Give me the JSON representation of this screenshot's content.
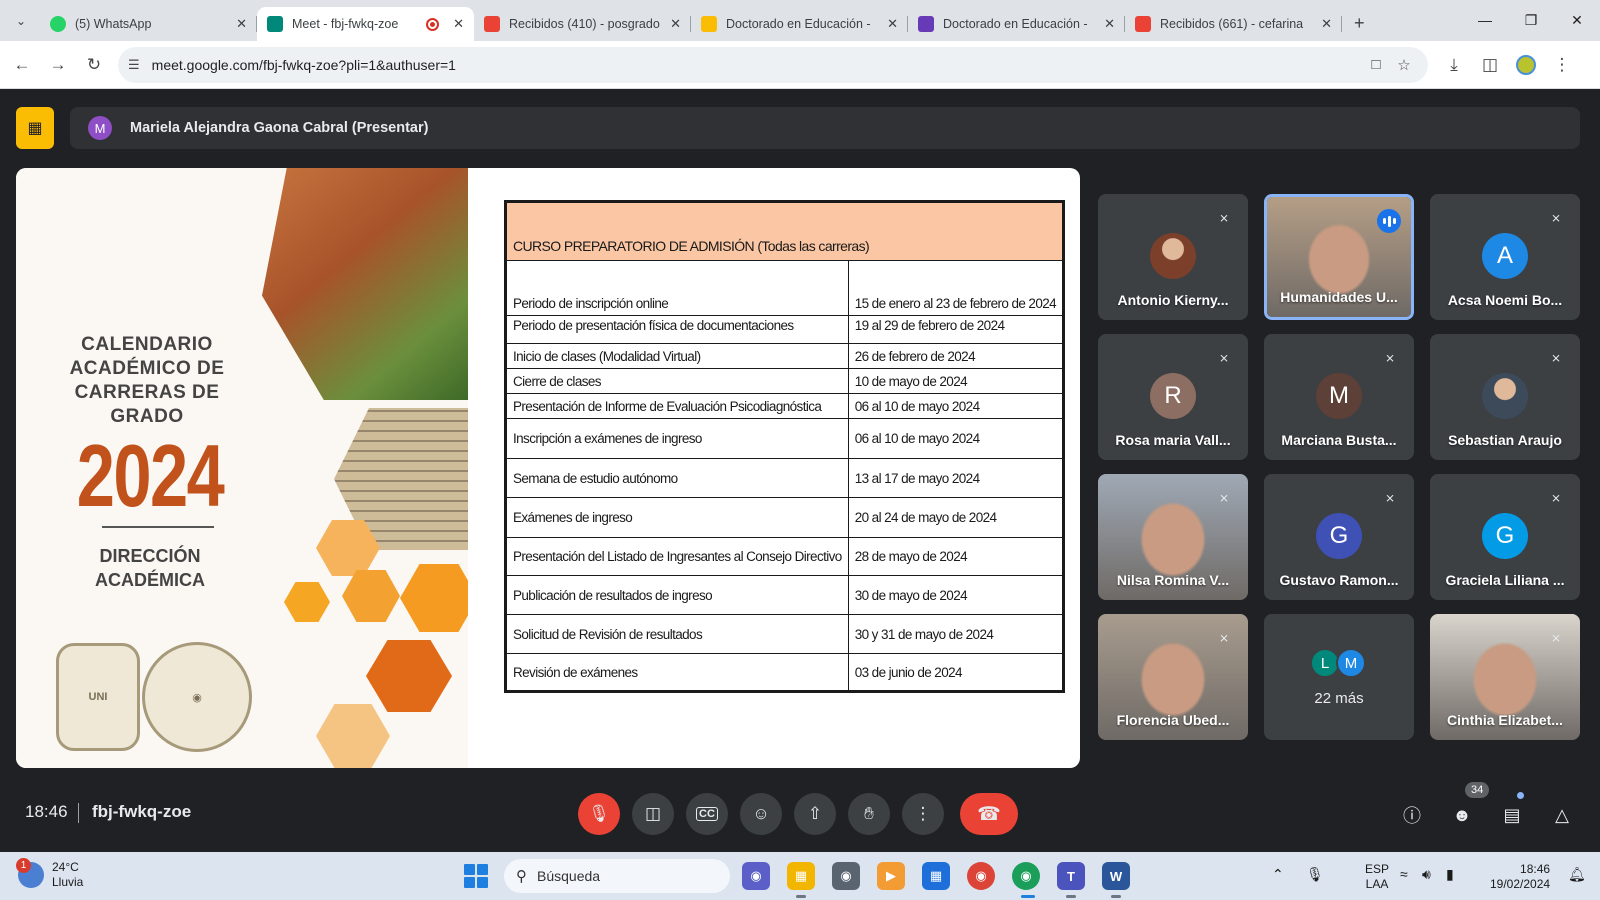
{
  "browser": {
    "tabs": [
      {
        "title": "(5) WhatsApp",
        "icon": "whatsapp-icon",
        "color": "#25d366",
        "active": false
      },
      {
        "title": "Meet - fbj-fwkq-zoe",
        "icon": "google-meet-icon",
        "color": "#00897b",
        "active": true,
        "recording": true
      },
      {
        "title": "Recibidos (410) - posgrado",
        "icon": "gmail-icon",
        "color": "#ea4335",
        "active": false
      },
      {
        "title": "Doctorado en Educación -",
        "icon": "google-drive-icon",
        "color": "#fbbc04",
        "active": false
      },
      {
        "title": "Doctorado en Educación -",
        "icon": "google-forms-icon",
        "color": "#673ab7",
        "active": false
      },
      {
        "title": "Recibidos (661) - cefarina",
        "icon": "gmail-icon",
        "color": "#ea4335",
        "active": false
      }
    ],
    "url": "meet.google.com/fbj-fwkq-zoe?pli=1&authuser=1"
  },
  "meet": {
    "presenter_label": "Mariela Alejandra Gaona Cabral (Presentar)",
    "presenter_initial": "M",
    "slide": {
      "title_lines": "CALENDARIO ACADÉMICO DE CARRERAS DE GRADO",
      "year": "2024",
      "direccion": "DIRECCIÓN ACADÉMICA",
      "seal_text": "UNI",
      "table_header": "CURSO PREPARATORIO DE ADMISIÓN (Todas las carreras)",
      "rows": [
        {
          "activity": "Periodo de inscripción online",
          "date": "15 de enero al 23 de febrero de 2024"
        },
        {
          "activity": "Periodo de presentación física de documentaciones",
          "date": "19 al 29 de febrero de 2024"
        },
        {
          "activity": "Inicio de clases (Modalidad Virtual)",
          "date": "26 de febrero de 2024"
        },
        {
          "activity": "Cierre de clases",
          "date": "10 de mayo de 2024"
        },
        {
          "activity": "Presentación de Informe de Evaluación Psicodiagnóstica",
          "date": "06  al 10 de mayo 2024"
        },
        {
          "activity": "Inscripción a exámenes de ingreso",
          "date": "06 al 10 de mayo 2024"
        },
        {
          "activity": "Semana de estudio autónomo",
          "date": "13 al 17 de mayo 2024"
        },
        {
          "activity": "Exámenes de ingreso",
          "date": "20 al 24 de mayo de 2024"
        },
        {
          "activity": "Presentación del Listado de Ingresantes al Consejo Directivo",
          "date": "28 de mayo de 2024"
        },
        {
          "activity": "Publicación de resultados de ingreso",
          "date": "30 de mayo de 2024"
        },
        {
          "activity": "Solicitud de Revisión de resultados",
          "date": "30 y 31 de mayo de 2024"
        },
        {
          "activity": "Revisión de exámenes",
          "date": "03 de junio de 2024"
        }
      ]
    },
    "participants": [
      {
        "name": "Antonio Kierny...",
        "type": "photo",
        "muted": true,
        "color": "#7b3f2a"
      },
      {
        "name": "Humanidades U...",
        "type": "video",
        "muted": false,
        "speaking": true,
        "color": "#b59e86"
      },
      {
        "name": "Acsa Noemi Bo...",
        "type": "avatar",
        "initial": "A",
        "muted": true,
        "color": "#1e88e5"
      },
      {
        "name": "Rosa maria Vall...",
        "type": "avatar",
        "initial": "R",
        "muted": true,
        "color": "#8d6e63"
      },
      {
        "name": "Marciana Busta...",
        "type": "avatar",
        "initial": "M",
        "muted": true,
        "color": "#5d4037"
      },
      {
        "name": "Sebastian Araujo",
        "type": "photo",
        "muted": true,
        "color": "#3d4a5a"
      },
      {
        "name": "Nilsa Romina V...",
        "type": "video",
        "muted": true,
        "color": "#9fa9b5"
      },
      {
        "name": "Gustavo Ramon...",
        "type": "avatar",
        "initial": "G",
        "muted": true,
        "color": "#3f51b5"
      },
      {
        "name": "Graciela Liliana ...",
        "type": "avatar",
        "initial": "G",
        "muted": true,
        "color": "#039be5"
      },
      {
        "name": "Florencia Ubed...",
        "type": "video",
        "muted": true,
        "color": "#a89c8e"
      },
      {
        "name": "22 más",
        "type": "more",
        "initials": [
          "L",
          "M"
        ],
        "colors": [
          "#00897b",
          "#1e88e5"
        ]
      },
      {
        "name": "Cinthia Elizabet...",
        "type": "video",
        "muted": true,
        "color": "#d9d4cc"
      }
    ],
    "time": "18:46",
    "meeting_code": "fbj-fwkq-zoe",
    "people_count": "34"
  },
  "taskbar": {
    "temperature": "24°C",
    "condition": "Lluvia",
    "weather_badge": "1",
    "search_placeholder": "Búsqueda",
    "language_line1": "ESP",
    "language_line2": "LAA",
    "time": "18:46",
    "date": "19/02/2024"
  }
}
